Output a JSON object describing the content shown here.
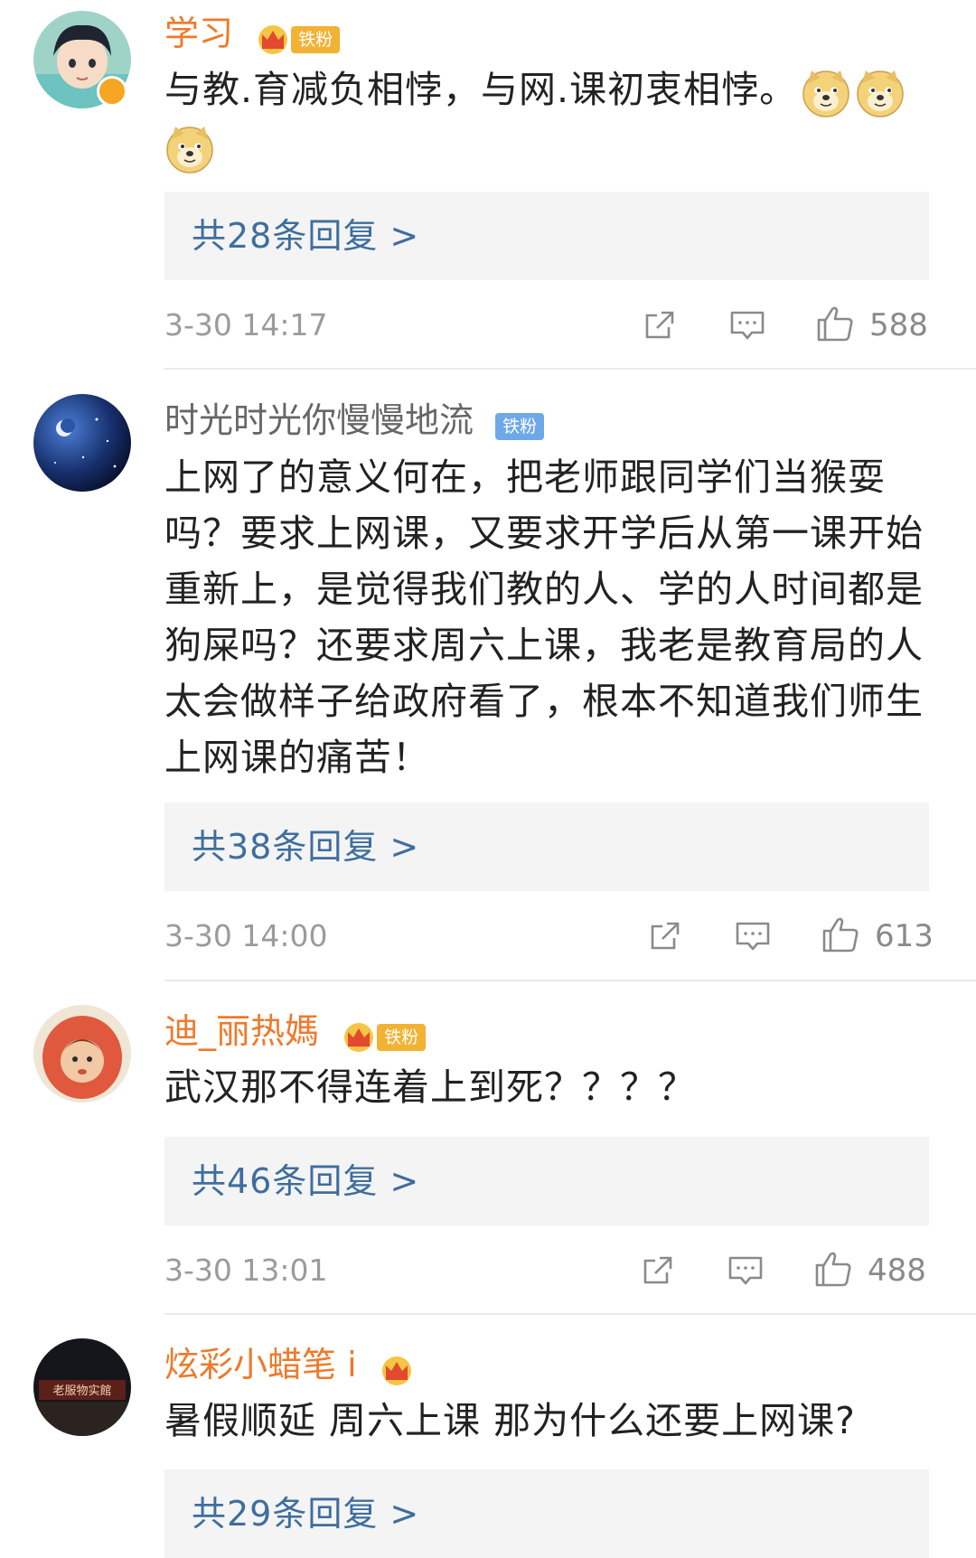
{
  "comments": [
    {
      "username": "学习",
      "fan_level": "6",
      "fan_label": "铁粉",
      "text": "与教.育减负相悖，与网.课初衷相悖。",
      "emoji": "doge",
      "replies": "共28条回复 >",
      "time": "3-30 14:17",
      "likes": "588"
    },
    {
      "username": "时光时光你慢慢地流",
      "fan_label": "铁粉",
      "text": "上网了的意义何在，把老师跟同学们当猴耍吗？要求上网课，又要求开学后从第一课开始重新上，是觉得我们教的人、学的人时间都是狗屎吗？还要求周六上课，我老是教育局的人太会做样子给政府看了，根本不知道我们师生上网课的痛苦！",
      "replies": "共38条回复 >",
      "time": "3-30 14:00",
      "likes": "613"
    },
    {
      "username": "迪_丽热媽",
      "fan_level": "2",
      "fan_label": "铁粉",
      "text": "武汉那不得连着上到死？？？？",
      "replies": "共46条回复 >",
      "time": "3-30 13:01",
      "likes": "488"
    },
    {
      "username": "炫彩小蜡笔 i",
      "fan_level": "2",
      "text": "暑假顺延 周六上课 那为什么还要上网课?",
      "replies": "共29条回复 >",
      "avatar_sign": "老服物实館"
    }
  ],
  "icons": [
    "share-icon",
    "comment-icon",
    "like-icon",
    "doge-emoji",
    "crown-icon",
    "verified-icon"
  ],
  "colors": {
    "username_orange": "#ee7a2b",
    "reply_link": "#3e6e9e",
    "reply_bg": "#f4f4f4",
    "fan_gold": "#f2b233",
    "fan_blue": "#6ea8e8"
  }
}
